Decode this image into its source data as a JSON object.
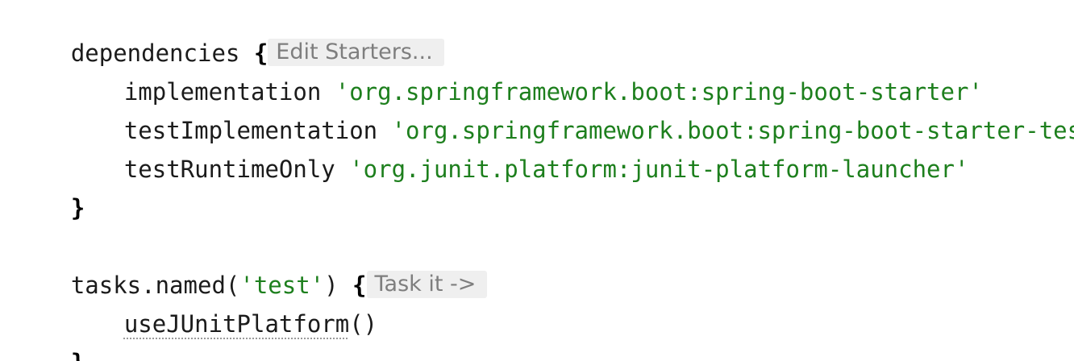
{
  "code": {
    "line1": {
      "keyword": "dependencies ",
      "brace_open": "{",
      "hint": "Edit Starters..."
    },
    "line2": {
      "config": "implementation ",
      "value": "'org.springframework.boot:spring-boot-starter'"
    },
    "line3": {
      "config": "testImplementation ",
      "value": "'org.springframework.boot:spring-boot-starter-test'"
    },
    "line4": {
      "config": "testRuntimeOnly ",
      "value": "'org.junit.platform:junit-platform-launcher'"
    },
    "line5": {
      "brace_close": "}"
    },
    "line7": {
      "prefix": "tasks.named(",
      "arg": "'test'",
      "suffix": ") ",
      "brace_open": "{",
      "hint": "Task it ->"
    },
    "line8": {
      "call": "useJUnitPlatform",
      "parens": "()"
    },
    "line9": {
      "brace_close": "}"
    }
  },
  "colors": {
    "string": "#1d7f1d",
    "text": "#1b1b1b",
    "hint_bg": "#efefef",
    "hint_text": "#7e7e7e"
  }
}
